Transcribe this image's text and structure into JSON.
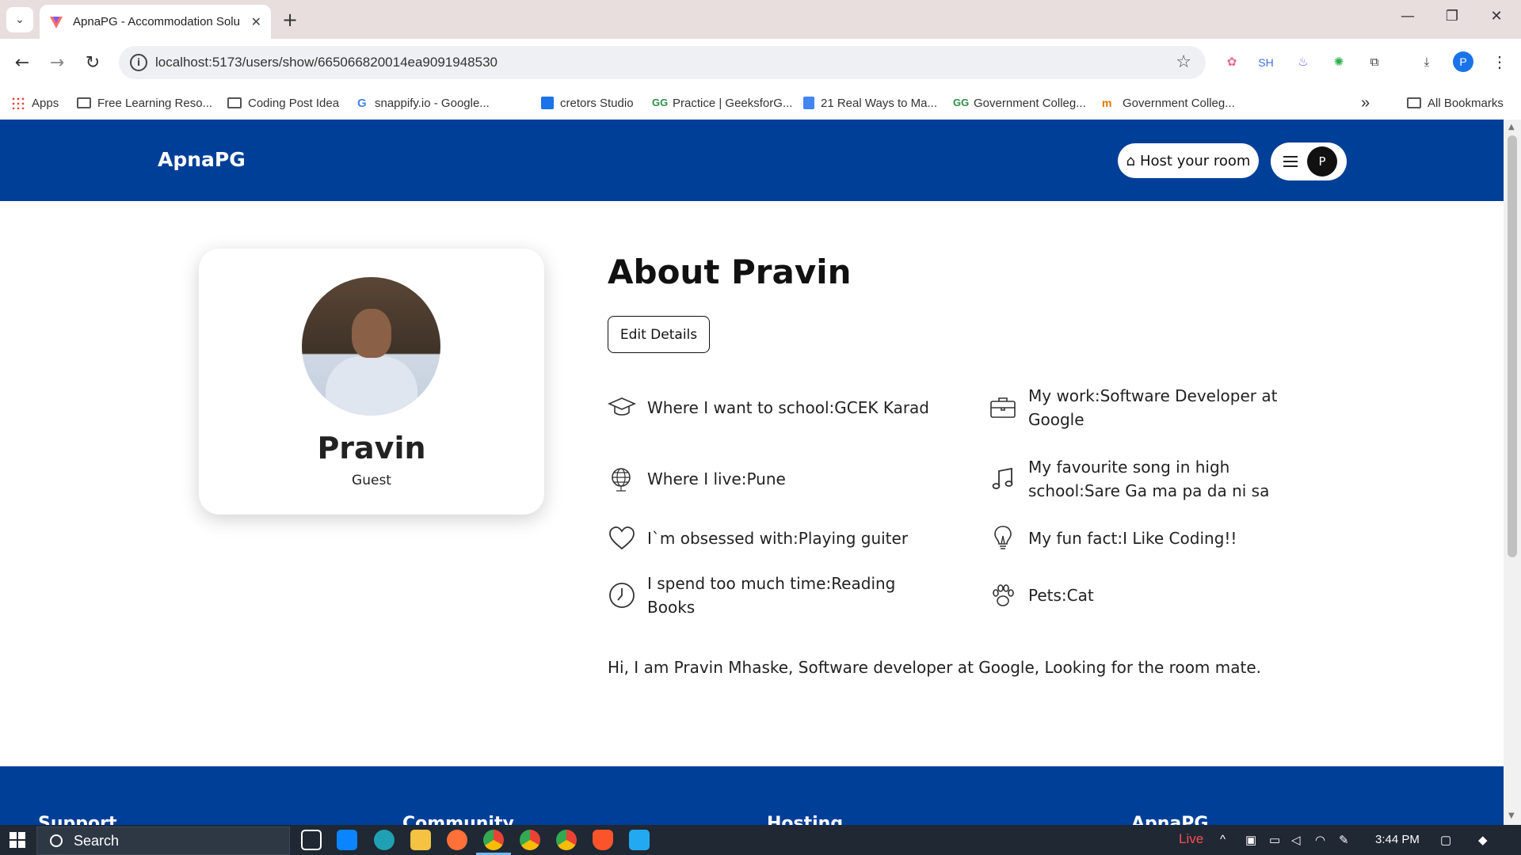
{
  "browser": {
    "tab_title": "ApnaPG - Accommodation Solu",
    "tab_close": "✕",
    "new_tab": "+",
    "url": "localhost:5173/users/show/665066820014ea9091948530",
    "minimize": "—",
    "restore": "❐",
    "close": "✕",
    "extensions": {
      "sh": "SH"
    },
    "profile_initial": "P",
    "bookmarks": [
      {
        "label": "Apps",
        "icon": "apps-grid-icon"
      },
      {
        "label": "Free Learning Reso...",
        "icon": "folder-icon"
      },
      {
        "label": "Coding Post Idea",
        "icon": "folder-icon"
      },
      {
        "label": "snappify.io - Google...",
        "icon": "google-icon"
      },
      {
        "label": "cretors Studio",
        "icon": "studio-icon"
      },
      {
        "label": "Practice | GeeksforG...",
        "icon": "gfg-icon"
      },
      {
        "label": "21 Real Ways to Ma...",
        "icon": "doc-icon"
      },
      {
        "label": "Government Colleg...",
        "icon": "gfg-icon"
      },
      {
        "label": "Government Colleg...",
        "icon": "college-icon"
      }
    ],
    "bookmarks_overflow": "»",
    "all_bookmarks": "All Bookmarks"
  },
  "navbar": {
    "brand": "ApnaPG",
    "host_label": "Host your room",
    "avatar_initial": "P"
  },
  "profile": {
    "name": "Pravin",
    "role": "Guest"
  },
  "about": {
    "title": "About Pravin",
    "edit_label": "Edit Details",
    "facts": [
      {
        "icon": "graduation-cap-icon",
        "text": "Where I want to school:GCEK Karad"
      },
      {
        "icon": "briefcase-icon",
        "text": "My work:Software Developer at Google"
      },
      {
        "icon": "globe-icon",
        "text": "Where I live:Pune"
      },
      {
        "icon": "music-note-icon",
        "text": "My favourite song in high school:Sare Ga ma pa da ni sa"
      },
      {
        "icon": "heart-icon",
        "text": "I`m obsessed with:Playing guiter"
      },
      {
        "icon": "lightbulb-icon",
        "text": "My fun fact:I Like Coding!!"
      },
      {
        "icon": "clock-icon",
        "text": "I spend too much time:Reading Books"
      },
      {
        "icon": "paw-icon",
        "text": "Pets:Cat"
      }
    ],
    "bio": "Hi, I am Pravin Mhaske, Software developer at Google, Looking for the room mate."
  },
  "footer": {
    "headings": [
      "Support",
      "Community",
      "Hosting",
      "ApnaPG"
    ]
  },
  "taskbar": {
    "search_label": "Search",
    "live_label": "Live",
    "time": "3:44 PM"
  },
  "colors": {
    "brand_blue": "#003f98",
    "page_bg": "#ffffff"
  }
}
